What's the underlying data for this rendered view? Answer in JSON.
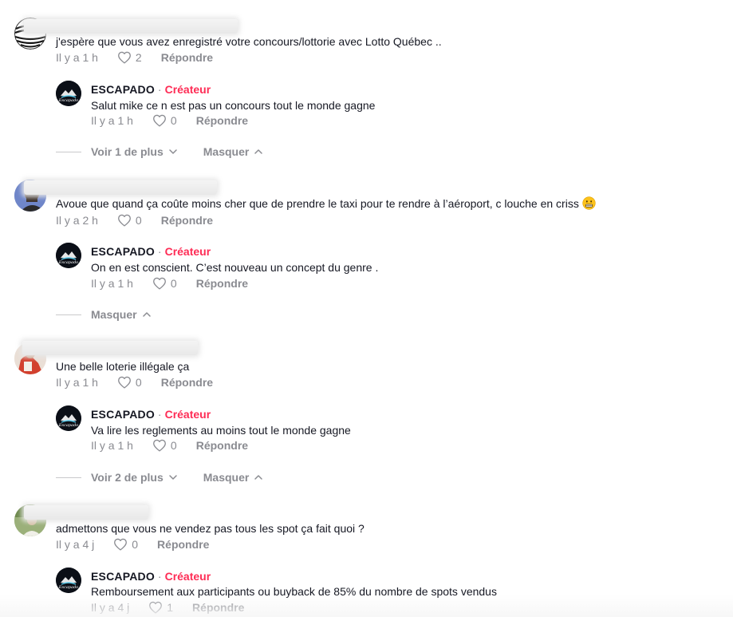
{
  "threads": [
    {
      "comment": {
        "text": "j'espère que vous avez enregistré votre concours/lottorie avec Lotto Québec ..",
        "time": "Il y a 1 h",
        "likes": "2",
        "reply_label": "Répondre"
      },
      "reply": {
        "author": "ESCAPADO",
        "separator": "·",
        "tag": "Créateur",
        "text": "Salut mike ce n est pas un concours tout le monde gagne",
        "time": "Il y a 1 h",
        "likes": "0",
        "reply_label": "Répondre"
      },
      "more_label": "Voir 1 de plus",
      "hide_label": "Masquer"
    },
    {
      "comment": {
        "text": "Avoue que quand ça coûte moins cher que de prendre le taxi pour te rendre à l’aéroport, c louche en criss",
        "time": "Il y a 2 h",
        "likes": "0",
        "reply_label": "Répondre"
      },
      "reply": {
        "author": "ESCAPADO",
        "separator": "·",
        "tag": "Créateur",
        "text": "On en est conscient. C’est nouveau un concept du genre .",
        "time": "Il y a 1 h",
        "likes": "0",
        "reply_label": "Répondre"
      },
      "hide_label": "Masquer"
    },
    {
      "comment": {
        "text": "Une belle loterie illégale ça",
        "time": "Il y a 1 h",
        "likes": "0",
        "reply_label": "Répondre"
      },
      "reply": {
        "author": "ESCAPADO",
        "separator": "·",
        "tag": "Créateur",
        "text": "Va lire les reglements au moins tout le monde gagne",
        "time": "Il y a 1 h",
        "likes": "0",
        "reply_label": "Répondre"
      },
      "more_label": "Voir 2 de plus",
      "hide_label": "Masquer"
    },
    {
      "comment": {
        "text": "admettons que vous ne vendez pas tous les spot ça fait quoi ?",
        "time": "Il y a 4 j",
        "likes": "0",
        "reply_label": "Répondre"
      },
      "reply": {
        "author": "ESCAPADO",
        "separator": "·",
        "tag": "Créateur",
        "text": "Remboursement aux participants ou buyback de 85% du nombre de spots vendus",
        "time": "Il y a 4 j",
        "likes": "1",
        "reply_label": "Répondre"
      }
    }
  ],
  "icons": {
    "heart": "heart-outline-icon",
    "chevron_down": "chevron-down-icon",
    "chevron_up": "chevron-up-icon",
    "emoji": "grimacing-face-emoji"
  },
  "colors": {
    "creator_tag": "#fe2c55",
    "muted": "#8a8b91",
    "text": "#161823"
  }
}
